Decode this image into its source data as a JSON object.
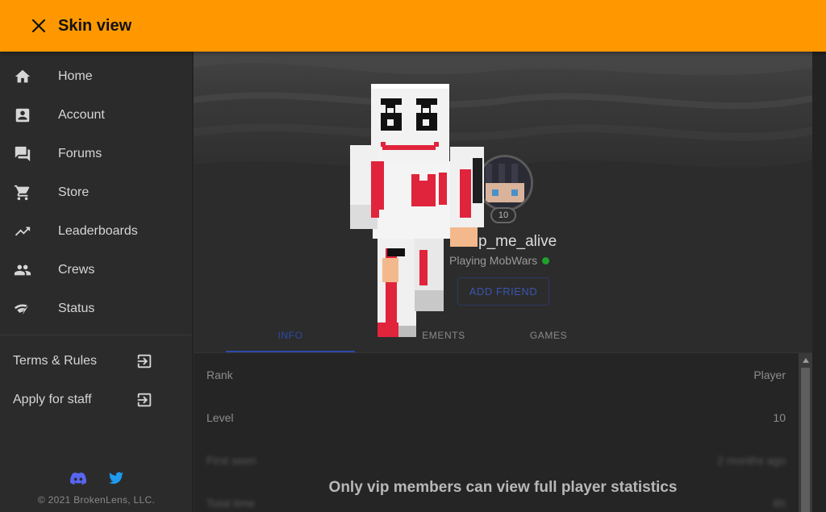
{
  "header": {
    "title": "Skin view"
  },
  "sidebar": {
    "items": [
      {
        "label": "Home",
        "icon": "home-icon"
      },
      {
        "label": "Account",
        "icon": "account-box-icon"
      },
      {
        "label": "Forums",
        "icon": "forum-icon"
      },
      {
        "label": "Store",
        "icon": "cart-icon"
      },
      {
        "label": "Leaderboards",
        "icon": "trending-up-icon"
      },
      {
        "label": "Crews",
        "icon": "group-icon"
      },
      {
        "label": "Status",
        "icon": "signal-icon"
      }
    ],
    "links": [
      {
        "label": "Terms & Rules",
        "icon": "exit-to-app-icon"
      },
      {
        "label": "Apply for staff",
        "icon": "exit-to-app-icon"
      }
    ],
    "footer": {
      "copyright": "© 2021 BrokenLens, LLC.",
      "social": [
        "discord-icon",
        "twitter-icon"
      ]
    }
  },
  "profile": {
    "username": "p_me_alive",
    "status": "Playing MobWars",
    "level": "10",
    "add_friend_label": "ADD FRIEND",
    "online_color": "#1fa12c"
  },
  "tabs": [
    {
      "label": "INFO",
      "active": true
    },
    {
      "label": "EMENTS",
      "active": false
    },
    {
      "label": "GAMES",
      "active": false
    }
  ],
  "stats": {
    "rows": [
      {
        "key": "Rank",
        "value": "Player"
      },
      {
        "key": "Level",
        "value": "10"
      },
      {
        "key": "First seen",
        "value": "2 months ago"
      },
      {
        "key": "Total time",
        "value": "6h"
      }
    ],
    "vip_message": "Only vip members can view full player statistics"
  },
  "colors": {
    "accent": "#ff9800",
    "tab_active": "#2c4aa8"
  }
}
